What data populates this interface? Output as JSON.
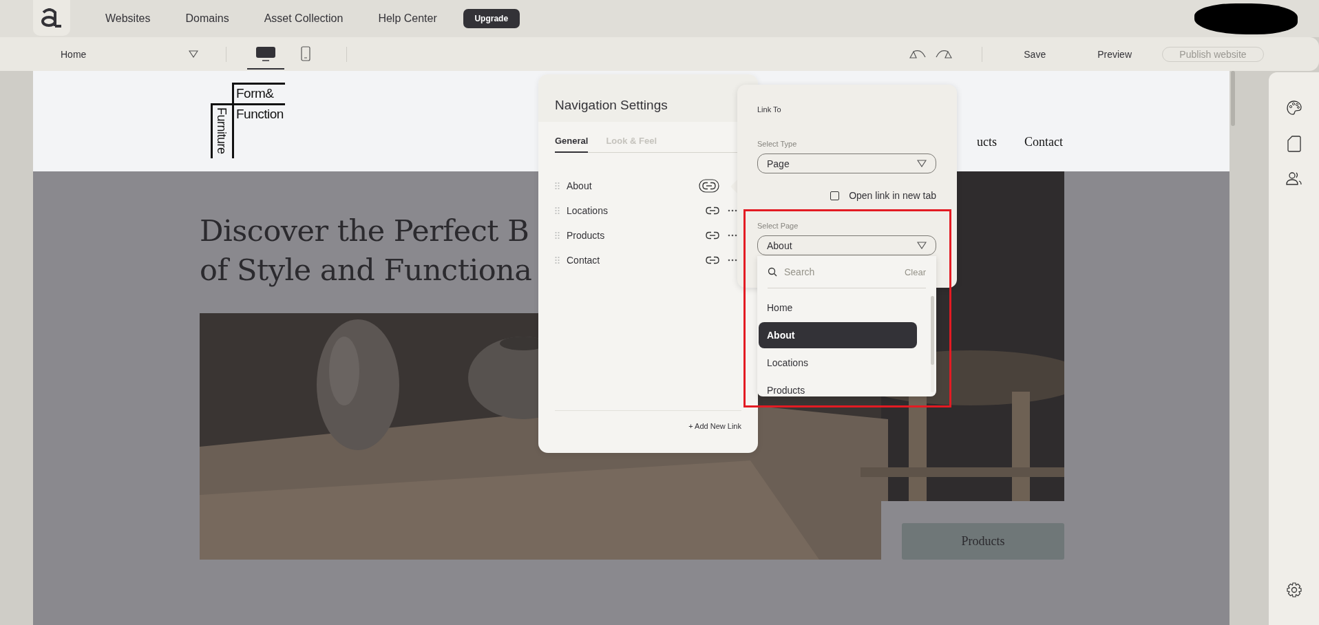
{
  "app_nav": {
    "links": [
      "Websites",
      "Domains",
      "Asset Collection",
      "Help Center"
    ],
    "upgrade": "Upgrade"
  },
  "toolbar": {
    "page": "Home",
    "devices": [
      {
        "kind": "desktop",
        "selected": true
      },
      {
        "kind": "mobile",
        "selected": false
      }
    ],
    "save": "Save",
    "preview": "Preview",
    "publish": {
      "label": "Publish website",
      "disabled": true
    }
  },
  "site": {
    "logo": {
      "top": "Form&",
      "main": "Function",
      "side": "Furniture"
    },
    "nav": [
      "ucts",
      "Contact"
    ],
    "heading": [
      "Discover the Perfect B",
      "of Style and Functiona"
    ],
    "button": "Products"
  },
  "nav_settings": {
    "title": "Navigation Settings",
    "tabs": [
      {
        "label": "General",
        "selected": true
      },
      {
        "label": "Look & Feel",
        "selected": false
      }
    ],
    "links": [
      {
        "label": "About",
        "selected": true
      },
      {
        "label": "Locations",
        "selected": false
      },
      {
        "label": "Products",
        "selected": false
      },
      {
        "label": "Contact",
        "selected": false
      }
    ],
    "add": "+ Add New Link"
  },
  "link_to": {
    "title": "Link To",
    "type_label": "Select Type",
    "type": "Page",
    "new_tab": {
      "label": "Open link in new tab",
      "checked": false
    },
    "page_label": "Select Page",
    "page": "About",
    "search": {
      "placeholder": "Search",
      "clear": "Clear"
    },
    "options": [
      {
        "label": "Home",
        "selected": false
      },
      {
        "label": "About",
        "selected": true
      },
      {
        "label": "Locations",
        "selected": false
      },
      {
        "label": "Products",
        "selected": false
      }
    ]
  }
}
